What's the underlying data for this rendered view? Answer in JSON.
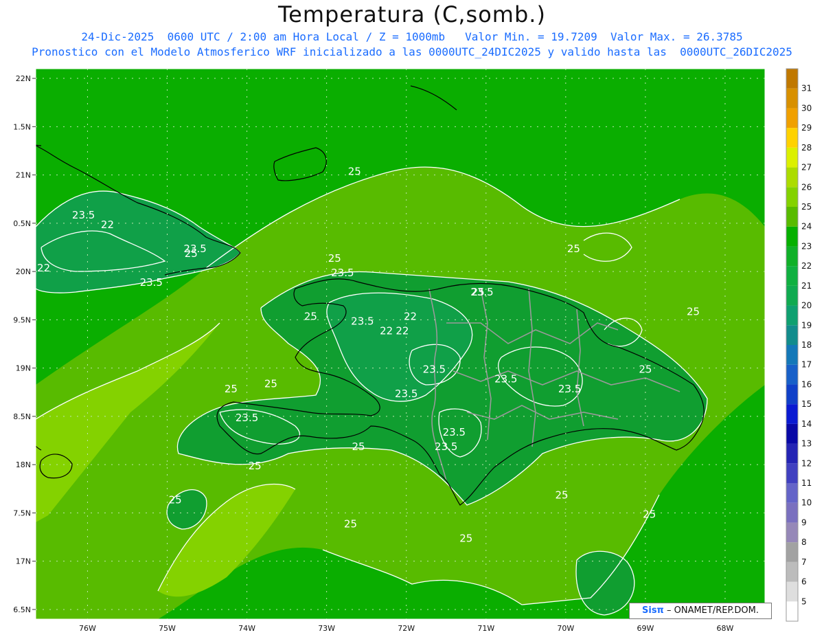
{
  "title": "Temperatura (C,somb.)",
  "subtitle1": "24-Dic-2025  0600 UTC / 2:00 am Hora Local / Z = 1000mb   Valor Min. = 19.7209  Valor Max. = 26.3785",
  "subtitle2": "Pronostico con el Modelo Atmosferico WRF inicializado a las 0000UTC_24DIC2025 y valido hasta las  0000UTC_26DIC2025",
  "logo": {
    "brand": "Sisπ",
    "text": " – ONAMET/REP.DOM."
  },
  "map": {
    "lon_range": [
      -76.65,
      -67.5
    ],
    "lat_range": [
      16.4,
      22.1
    ],
    "lon_ticks": [
      "76W",
      "75W",
      "74W",
      "73W",
      "72W",
      "71W",
      "70W",
      "69W",
      "68W"
    ],
    "lat_ticks": [
      "22N",
      "1.5N",
      "21N",
      "0.5N",
      "20N",
      "9.5N",
      "19N",
      "8.5N",
      "18N",
      "7.5N",
      "17N",
      "6.5N"
    ],
    "contour_labels": [
      {
        "text": "25",
        "lon": -72.65,
        "lat": 21.0
      },
      {
        "text": "25",
        "lon": -69.9,
        "lat": 20.2
      },
      {
        "text": "25",
        "lon": -72.9,
        "lat": 20.1
      },
      {
        "text": "25",
        "lon": -71.1,
        "lat": 19.75
      },
      {
        "text": "25",
        "lon": -73.2,
        "lat": 19.5
      },
      {
        "text": "25",
        "lon": -68.4,
        "lat": 19.55
      },
      {
        "text": "25",
        "lon": -69.0,
        "lat": 18.95
      },
      {
        "text": "25",
        "lon": -74.2,
        "lat": 18.75
      },
      {
        "text": "25",
        "lon": -73.7,
        "lat": 18.8
      },
      {
        "text": "25",
        "lon": -72.6,
        "lat": 18.15
      },
      {
        "text": "25",
        "lon": -73.9,
        "lat": 17.95
      },
      {
        "text": "25",
        "lon": -74.7,
        "lat": 20.15
      },
      {
        "text": "25",
        "lon": -74.9,
        "lat": 17.6
      },
      {
        "text": "25",
        "lon": -70.05,
        "lat": 17.65
      },
      {
        "text": "25",
        "lon": -68.95,
        "lat": 17.45
      },
      {
        "text": "25",
        "lon": -72.7,
        "lat": 17.35
      },
      {
        "text": "25",
        "lon": -71.25,
        "lat": 17.2
      },
      {
        "text": "23.5",
        "lon": -76.05,
        "lat": 20.55
      },
      {
        "text": "22",
        "lon": -75.75,
        "lat": 20.45
      },
      {
        "text": "23.5",
        "lon": -74.65,
        "lat": 20.2
      },
      {
        "text": "22",
        "lon": -76.55,
        "lat": 20.0
      },
      {
        "text": "23.5",
        "lon": -75.2,
        "lat": 19.85
      },
      {
        "text": "23.5",
        "lon": -72.8,
        "lat": 19.95
      },
      {
        "text": "23.5",
        "lon": -72.55,
        "lat": 19.45
      },
      {
        "text": "22",
        "lon": -72.25,
        "lat": 19.35
      },
      {
        "text": "22",
        "lon": -72.05,
        "lat": 19.35
      },
      {
        "text": "22",
        "lon": -71.95,
        "lat": 19.5
      },
      {
        "text": "23.5",
        "lon": -71.05,
        "lat": 19.75
      },
      {
        "text": "23.5",
        "lon": -71.65,
        "lat": 18.95
      },
      {
        "text": "23.5",
        "lon": -70.75,
        "lat": 18.85
      },
      {
        "text": "23.5",
        "lon": -69.95,
        "lat": 18.75
      },
      {
        "text": "23.5",
        "lon": -72.0,
        "lat": 18.7
      },
      {
        "text": "23.5",
        "lon": -74.0,
        "lat": 18.45
      },
      {
        "text": "23.5",
        "lon": -71.4,
        "lat": 18.3
      },
      {
        "text": "23.5",
        "lon": -71.5,
        "lat": 18.15
      }
    ]
  },
  "colorbar": {
    "labels": [
      "5",
      "6",
      "7",
      "8",
      "9",
      "10",
      "11",
      "12",
      "13",
      "14",
      "15",
      "16",
      "17",
      "18",
      "19",
      "20",
      "21",
      "22",
      "23",
      "24",
      "25",
      "26",
      "27",
      "28",
      "29",
      "30",
      "31"
    ],
    "colors": [
      "#ffffff",
      "#dedede",
      "#bcbcbc",
      "#a2a2a2",
      "#9688b8",
      "#7a70bf",
      "#6464c8",
      "#4040c0",
      "#2424b4",
      "#0808a6",
      "#0a1ad2",
      "#1040c8",
      "#1860c8",
      "#1478b8",
      "#128c8c",
      "#0fa070",
      "#10aa50",
      "#10b040",
      "#10b028",
      "#06b000",
      "#58bb00",
      "#84d200",
      "#acdc00",
      "#dcf000",
      "#ffd200",
      "#f0a000",
      "#d89000",
      "#c07800"
    ]
  },
  "colors": {
    "field24": "#0aae00",
    "field22": "#10a048",
    "field26": "#58bb00",
    "field27": "#84d200",
    "field235": "#109e30",
    "contour": "#ffffff",
    "border": "#9a9a9a",
    "coast": "#000000"
  }
}
